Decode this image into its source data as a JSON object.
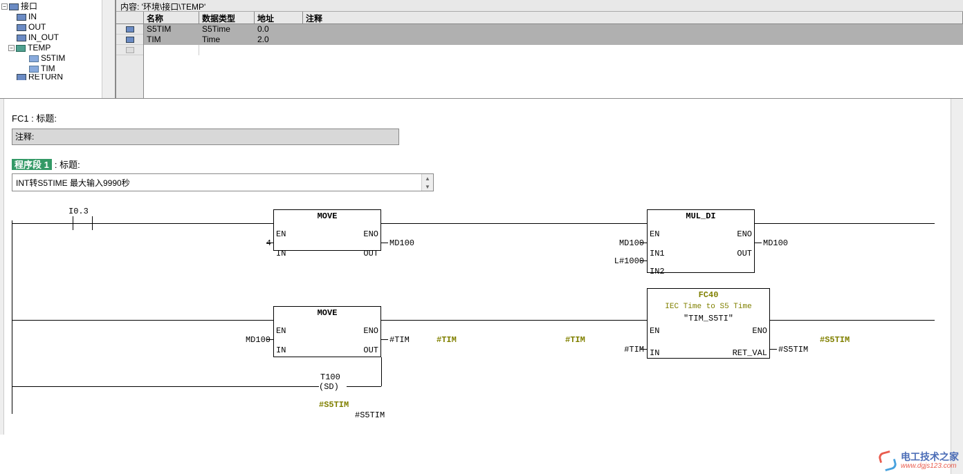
{
  "header": {
    "content_path": "内容:  '环境\\接口\\TEMP'"
  },
  "tree": {
    "root": "接口",
    "items": [
      {
        "label": "IN",
        "icon": "blue",
        "indent": 22
      },
      {
        "label": "OUT",
        "icon": "blue",
        "indent": 22
      },
      {
        "label": "IN_OUT",
        "icon": "blue",
        "indent": 22
      },
      {
        "label": "TEMP",
        "icon": "teal",
        "indent": 22,
        "expandable": true
      },
      {
        "label": "S5TIM",
        "icon": "cyan",
        "indent": 40
      },
      {
        "label": "TIM",
        "icon": "cyan",
        "indent": 40
      },
      {
        "label": "RETURN",
        "icon": "blue",
        "indent": 22,
        "cut": true
      }
    ]
  },
  "table": {
    "headers": {
      "name": "名称",
      "type": "数据类型",
      "addr": "地址",
      "comment": "注释"
    },
    "rows": [
      {
        "name": "S5TIM",
        "type": "S5Time",
        "addr": "0.0"
      },
      {
        "name": "TIM",
        "type": "Time",
        "addr": "2.0"
      }
    ]
  },
  "fc": {
    "title": "FC1 : 标题:",
    "comment_label": "注释:",
    "segment_badge": "程序段 1",
    "segment_title_label": ": 标题:",
    "segment_comment": "INT转S5TIME 最大输入9990秒"
  },
  "ladder": {
    "contact": "I0.3",
    "move1": {
      "title": "MOVE",
      "en": "EN",
      "eno": "ENO",
      "in": "IN",
      "out": "OUT",
      "in_val": "4",
      "out_val": "MD100"
    },
    "mul": {
      "title": "MUL_DI",
      "en": "EN",
      "eno": "ENO",
      "in1": "IN1",
      "in2": "IN2",
      "out": "OUT",
      "in1_val": "MD100",
      "in2_val": "L#1000",
      "out_val": "MD100"
    },
    "move2": {
      "title": "MOVE",
      "en": "EN",
      "eno": "ENO",
      "in": "IN",
      "out": "OUT",
      "in_val": "MD100",
      "out_val": "#TIM"
    },
    "fc40": {
      "name": "FC40",
      "desc": "IEC Time to S5 Time",
      "inst": "\"TIM_S5TI\"",
      "en": "EN",
      "eno": "ENO",
      "in": "IN",
      "ret": "RET_VAL",
      "in_val": "#TIM",
      "out_val": "#S5TIM"
    },
    "tim_disp": "#TIM",
    "s5tim_disp": "#S5TIM",
    "timer": {
      "name": "T100",
      "type": "(SD)",
      "in_val": "#S5TIM",
      "disp": "#S5TIM"
    }
  },
  "watermark": {
    "cn": "电工技术之家",
    "url": "www.dgjs123.com"
  }
}
